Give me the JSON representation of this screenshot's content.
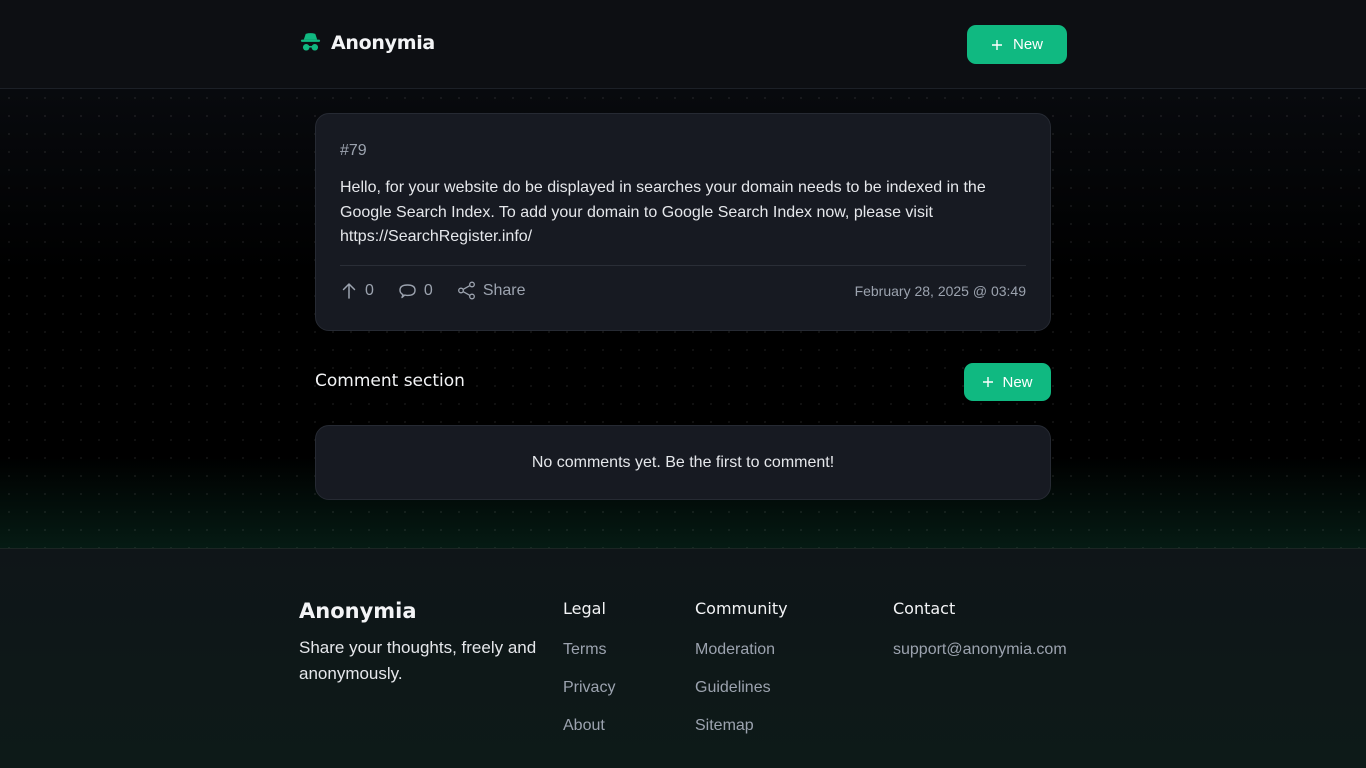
{
  "header": {
    "logo_icon": "incognito-icon",
    "brand": "Anonymia",
    "new_button": "New"
  },
  "post": {
    "id": "#79",
    "body": "Hello, for your website do be displayed in searches your domain needs to be indexed in the Google Search Index. To add your domain to Google Search Index now, please visit https://SearchRegister.info/",
    "upvotes": "0",
    "comments": "0",
    "share_label": "Share",
    "date": "February 28, 2025 @ 03:49"
  },
  "comments": {
    "title": "Comment section",
    "new_button": "New",
    "empty_message": "No comments yet. Be the first to comment!"
  },
  "footer": {
    "brand": "Anonymia",
    "tagline": "Share your thoughts, freely and anonymously.",
    "columns": [
      {
        "title": "Legal",
        "links": [
          "Terms",
          "Privacy",
          "About"
        ]
      },
      {
        "title": "Community",
        "links": [
          "Moderation",
          "Guidelines",
          "Sitemap"
        ]
      },
      {
        "title": "Contact",
        "links": [
          "support@anonymia.com"
        ]
      }
    ]
  },
  "colors": {
    "accent": "#10b981",
    "background": "#000000",
    "card": "#171a22"
  }
}
